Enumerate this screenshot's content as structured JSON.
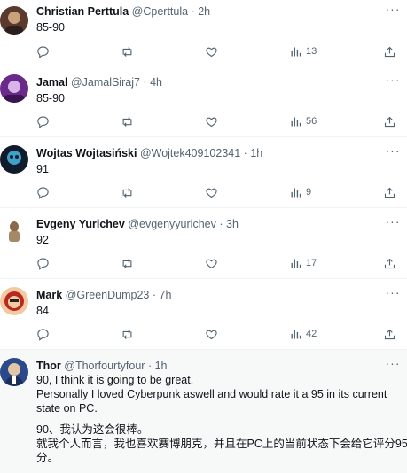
{
  "replies": [
    {
      "name": "Christian Perttula",
      "handle": "@Cperttula",
      "time": "2h",
      "lines": [
        "85-90"
      ],
      "views": "13",
      "avatar_colors": [
        "#5a3a2e",
        "#c9a27c"
      ]
    },
    {
      "name": "Jamal",
      "handle": "@JamalSiraj7",
      "time": "4h",
      "lines": [
        "85-90"
      ],
      "views": "56",
      "avatar_colors": [
        "#6a2a8a",
        "#d8b4e8"
      ]
    },
    {
      "name": "Wojtas Wojtasiński",
      "handle": "@Wojtek409102341",
      "time": "1h",
      "lines": [
        "91"
      ],
      "views": "9",
      "avatar_colors": [
        "#101c2c",
        "#3da1c9"
      ]
    },
    {
      "name": "Evgeny Yurichev",
      "handle": "@evgenyyurichev",
      "time": "3h",
      "lines": [
        "92"
      ],
      "views": "17",
      "avatar_colors": [
        "#e9e2d6",
        "#8a6a4a"
      ]
    },
    {
      "name": "Mark",
      "handle": "@GreenDump23",
      "time": "7h",
      "lines": [
        "84"
      ],
      "views": "42",
      "avatar_colors": [
        "#b7281f",
        "#f2c9a0"
      ]
    },
    {
      "name": "Thor",
      "handle": "@Thorfourtyfour",
      "time": "1h",
      "lines": [
        "90, I think it is going to be great.",
        "Personally I loved Cyberpunk aswell and would rate it a 95 in its current",
        "state on PC.",
        "",
        "90、我认为这会很棒。",
        "就我个人而言，我也喜欢赛博朋克，并且在PC上的当前状态下会给它评分95",
        "分。"
      ],
      "avatar_colors": [
        "#2a4a8a",
        "#e3c6a6"
      ]
    }
  ],
  "colors": {
    "text": "#0f1419",
    "muted": "#536471",
    "divider": "#eff3f4",
    "highlight_bg": "#f7f9f9"
  },
  "icons": {
    "more": "more-horizontal-icon",
    "reply": "reply-icon",
    "retweet": "retweet-icon",
    "like": "like-icon",
    "views": "views-icon",
    "share": "share-icon"
  }
}
